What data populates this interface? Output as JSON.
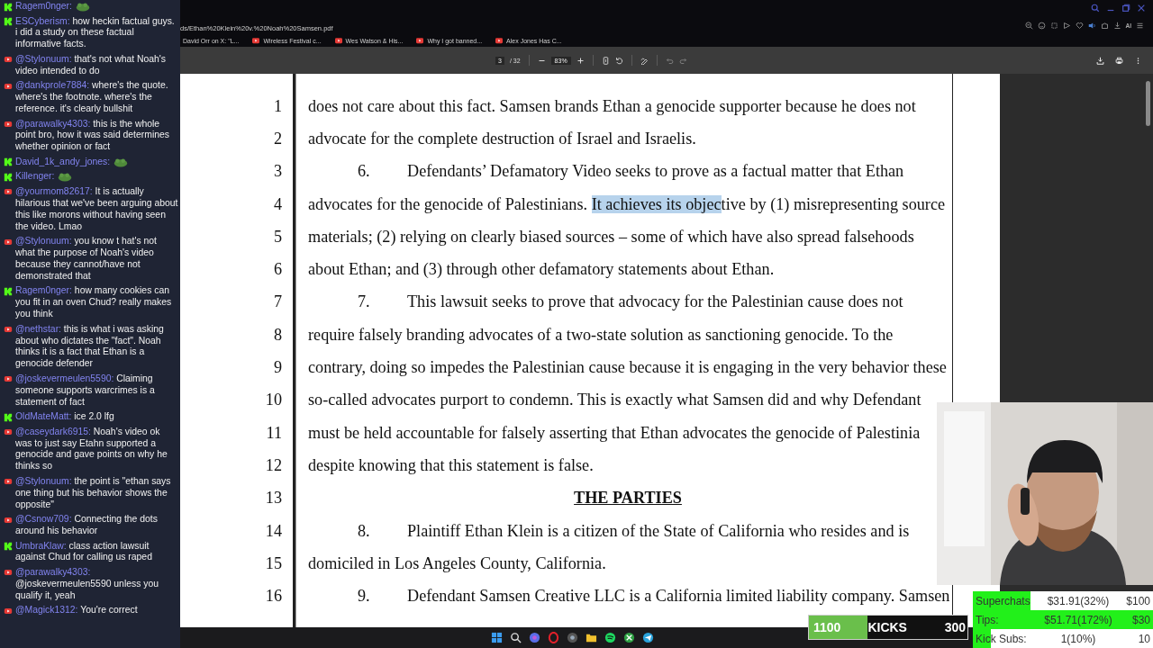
{
  "chat": {
    "messages": [
      {
        "kind": "kick",
        "emote": true,
        "user": "Ragem0nger:"
      },
      {
        "kind": "kick",
        "emote": false,
        "user": "ESCyberism:",
        "text": "how heckin factual guys. i did a study on these factual informative facts."
      },
      {
        "kind": "youtube",
        "emote": false,
        "user": "@Stylonuum:",
        "text": "that's not what Noah's video intended to do"
      },
      {
        "kind": "youtube",
        "emote": false,
        "user": "@dankprole7884:",
        "text": "where's the quote. where's the footnote. where's the reference. it's clearly bullshit"
      },
      {
        "kind": "youtube",
        "emote": false,
        "user": "@parawalky4303:",
        "text": "this is the whole point bro, how it was said determines whether opinion or fact"
      },
      {
        "kind": "kick",
        "emote": true,
        "user": "David_1k_andy_jones:"
      },
      {
        "kind": "kick",
        "emote": true,
        "user": "Killenger:"
      },
      {
        "kind": "youtube",
        "emote": false,
        "user": "@yourmom82617:",
        "text": "It is actually hilarious that we've been arguing about this like morons without having seen the video. Lmao"
      },
      {
        "kind": "youtube",
        "emote": false,
        "user": "@Stylonuum:",
        "text": "you know t hat's not what the purpose of Noah's video because they cannot/have not demonstrated that"
      },
      {
        "kind": "kick",
        "emote": false,
        "user": "Ragem0nger:",
        "text": "how many cookies can you fit in an oven Chud? really makes you think"
      },
      {
        "kind": "youtube",
        "emote": false,
        "user": "@nethstar:",
        "text": "this is what i was asking about who dictates the \"fact\". Noah thinks it is a fact that Ethan is a genocide defender"
      },
      {
        "kind": "youtube",
        "emote": false,
        "user": "@joskevermeulen5590:",
        "text": "Claiming someone supports warcrimes is a statement of fact"
      },
      {
        "kind": "kick",
        "emote": false,
        "user": "OldMateMatt:",
        "text": "ice 2.0 lfg"
      },
      {
        "kind": "youtube",
        "emote": false,
        "user": "@caseydark6915:",
        "text": "Noah's video ok was to just say Etahn supported a genocide and gave points on why he thinks so"
      },
      {
        "kind": "youtube",
        "emote": false,
        "user": "@Stylonuum:",
        "text": "the point is \"ethan says one thing but his behavior shows the opposite\""
      },
      {
        "kind": "youtube",
        "emote": false,
        "user": "@Csnow709:",
        "text": "Connecting the dots around his behavior"
      },
      {
        "kind": "kick",
        "emote": false,
        "user": "UmbraKlaw:",
        "text": "class action lawsuit against Chud for calling us raped"
      },
      {
        "kind": "youtube",
        "emote": false,
        "user": "@parawalky4303:",
        "text": "@joskevermeulen5590 unless you qualify it, yeah"
      },
      {
        "kind": "youtube",
        "emote": false,
        "user": "@Magick1312:",
        "text": "You're correct"
      }
    ]
  },
  "browser": {
    "url": "ds/Ethan%20Klein%20v.%20Noah%20Samsen.pdf",
    "bookmarks": [
      {
        "label": "David Orr on X: \"L...",
        "kind": "plain"
      },
      {
        "label": "Wireless Festival c...",
        "kind": "youtube"
      },
      {
        "label": "Wes Watson & His...",
        "kind": "youtube"
      },
      {
        "label": "Why I got banned...",
        "kind": "youtube"
      },
      {
        "label": "Alex Jones Has C...",
        "kind": "youtube"
      }
    ],
    "ai_label": "AI"
  },
  "pdf_toolbar": {
    "page": "3",
    "page_count": "/ 32",
    "zoom": "83%"
  },
  "document": {
    "lines": [
      {
        "number": "1",
        "kind": "plain",
        "text": "does not care about this fact. Samsen brands Ethan a genocide supporter because he does not"
      },
      {
        "number": "2",
        "kind": "plain",
        "text": "advocate for the complete destruction of Israel and Israelis."
      },
      {
        "number": "3",
        "kind": "paragraph",
        "para_number": "6.",
        "text": "Defendants’ Defamatory Video seeks to prove as a factual matter that Ethan"
      },
      {
        "number": "4",
        "kind": "plain",
        "segments": [
          {
            "text": "advocates for the genocide of Palestinians. ",
            "highlighted": false
          },
          {
            "text": "It achieves its objec",
            "highlighted": true
          },
          {
            "text": "tive by (1) misrepresenting source",
            "highlighted": false
          }
        ]
      },
      {
        "number": "5",
        "kind": "plain",
        "text": "materials; (2) relying on clearly biased sources – some of which have also spread falsehoods"
      },
      {
        "number": "6",
        "kind": "plain",
        "text": "about Ethan; and (3) through other defamatory statements about Ethan."
      },
      {
        "number": "7",
        "kind": "paragraph",
        "para_number": "7.",
        "text": "This lawsuit seeks to prove that advocacy for the Palestinian cause does not"
      },
      {
        "number": "8",
        "kind": "plain",
        "text": "require falsely branding advocates of a two-state solution as sanctioning genocide. To the"
      },
      {
        "number": "9",
        "kind": "plain",
        "text": "contrary, doing so impedes the Palestinian cause because it is engaging in the very behavior these"
      },
      {
        "number": "10",
        "kind": "plain",
        "text": "so-called advocates purport to condemn. This is exactly what Samsen did and why Defendant"
      },
      {
        "number": "11",
        "kind": "plain",
        "text": "must be held accountable for falsely asserting that Ethan advocates the genocide of Palestinia"
      },
      {
        "number": "12",
        "kind": "plain",
        "text": "despite knowing that this statement is false."
      },
      {
        "number": "13",
        "kind": "heading",
        "text": "THE PARTIES"
      },
      {
        "number": "14",
        "kind": "paragraph",
        "para_number": "8.",
        "text": "Plaintiff Ethan Klein is a citizen of the State of California who resides and is"
      },
      {
        "number": "15",
        "kind": "plain",
        "text": "domiciled in Los Angeles County, California."
      },
      {
        "number": "16",
        "kind": "paragraph",
        "para_number": "9.",
        "text": "Defendant Samsen Creative LLC is a California limited liability company. Samsen"
      }
    ]
  },
  "kicks_goal": {
    "current": "1100",
    "label": "KICKS",
    "target": "300",
    "level": 0.37
  },
  "goals": [
    {
      "label": "Superchats",
      "value": "$31.91(32%)",
      "target": "$100",
      "level": 0.32
    },
    {
      "label": "Tips:",
      "value": "$51.71(172%)",
      "target": "$30",
      "level": 1
    },
    {
      "label": "Kick Subs:",
      "value": "1(10%)",
      "target": "10",
      "level": 0.1
    }
  ]
}
